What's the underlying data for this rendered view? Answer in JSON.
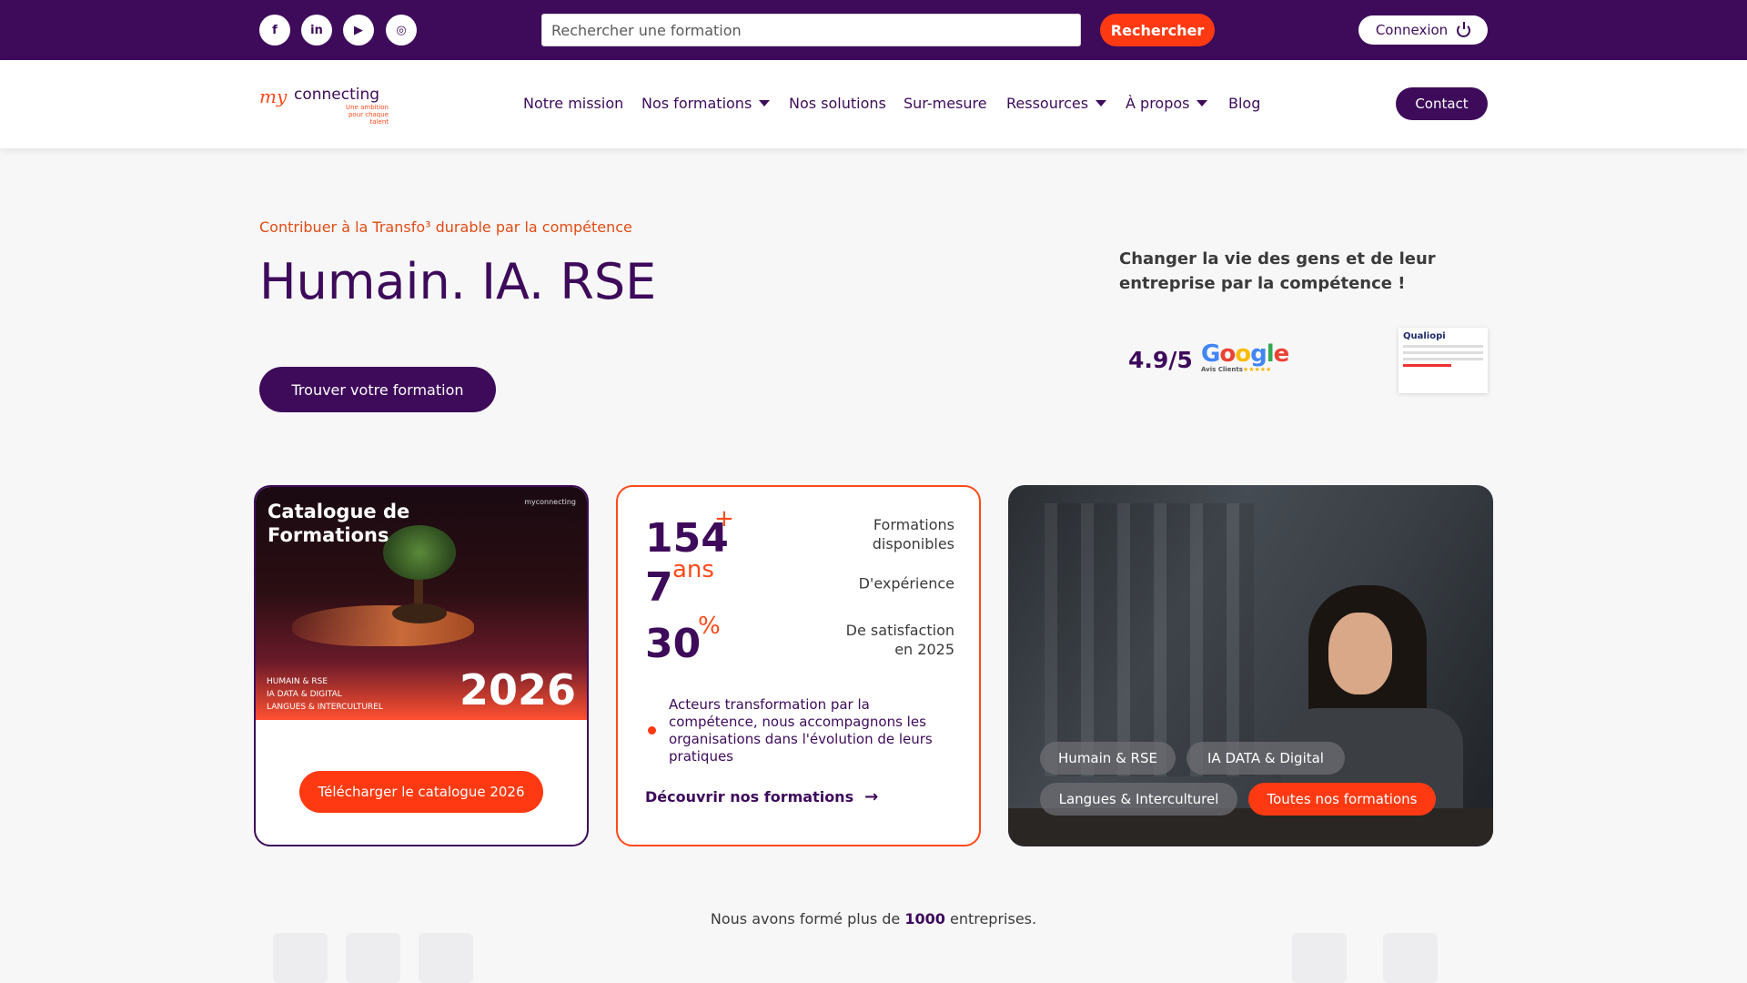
{
  "topbar": {
    "social": [
      {
        "name": "facebook-icon",
        "glyph": "f"
      },
      {
        "name": "linkedin-icon",
        "glyph": "in"
      },
      {
        "name": "youtube-icon",
        "glyph": "▶"
      },
      {
        "name": "instagram-icon",
        "glyph": "◎"
      }
    ],
    "search_placeholder": "Rechercher une formation",
    "search_button": "Rechercher",
    "login_label": "Connexion"
  },
  "nav": {
    "logo_my": "my",
    "logo_connecting": "connecting",
    "logo_tagline": "Une ambition pour chaque talent",
    "items": [
      {
        "label": "Notre mission",
        "dropdown": false
      },
      {
        "label": "Nos formations",
        "dropdown": true
      },
      {
        "label": "Nos solutions",
        "dropdown": false
      },
      {
        "label": "Sur-mesure",
        "dropdown": false
      },
      {
        "label": "Ressources",
        "dropdown": true
      },
      {
        "label": "À propos",
        "dropdown": true
      },
      {
        "label": "Blog",
        "dropdown": false
      }
    ],
    "contact_label": "Contact"
  },
  "hero": {
    "eyebrow": "Contribuer à la Transfo³ durable par la compétence",
    "title": "Humain. IA. RSE",
    "cta_label": "Trouver votre formation",
    "tagline": "Changer la vie des gens et de leur entreprise par la compétence !",
    "rating": "4.9/5",
    "google_sub": "Avis Clients",
    "google_stars": "★★★★★",
    "qualiopi_label": "Qualiopi"
  },
  "catalog": {
    "title": "Catalogue de Formations",
    "logo_text": "myconnecting",
    "topics": [
      "HUMAIN & RSE",
      "IA DATA & DIGITAL",
      "LANGUES & INTERCULTUREL"
    ],
    "year": "2026",
    "download_label": "Télécharger le catalogue 2026"
  },
  "stats": {
    "items": [
      {
        "number": "154",
        "suffix": "+",
        "label": "Formations disponibles"
      },
      {
        "number": "7",
        "suffix": "ans",
        "label": "D'expérience"
      },
      {
        "number": "30",
        "suffix": "%",
        "label": "De satisfaction en 2025"
      }
    ],
    "bullet": "Acteurs transformation par la compétence, nous accompagnons les organisations dans l'évolution de leurs pratiques",
    "discover_label": "Découvrir nos formations",
    "discover_arrow": "→"
  },
  "categories": {
    "pills": [
      {
        "label": "Humain & RSE",
        "active": false
      },
      {
        "label": "IA DATA & Digital",
        "active": false
      },
      {
        "label": "Langues & Interculturel",
        "active": false
      },
      {
        "label": "Toutes nos formations",
        "active": true
      }
    ]
  },
  "trust": {
    "prefix": "Nous avons formé plus de",
    "count": "1000",
    "suffix": "entreprises."
  },
  "colors": {
    "brand_purple": "#3e0b5b",
    "accent_orange": "#ff3a12"
  }
}
